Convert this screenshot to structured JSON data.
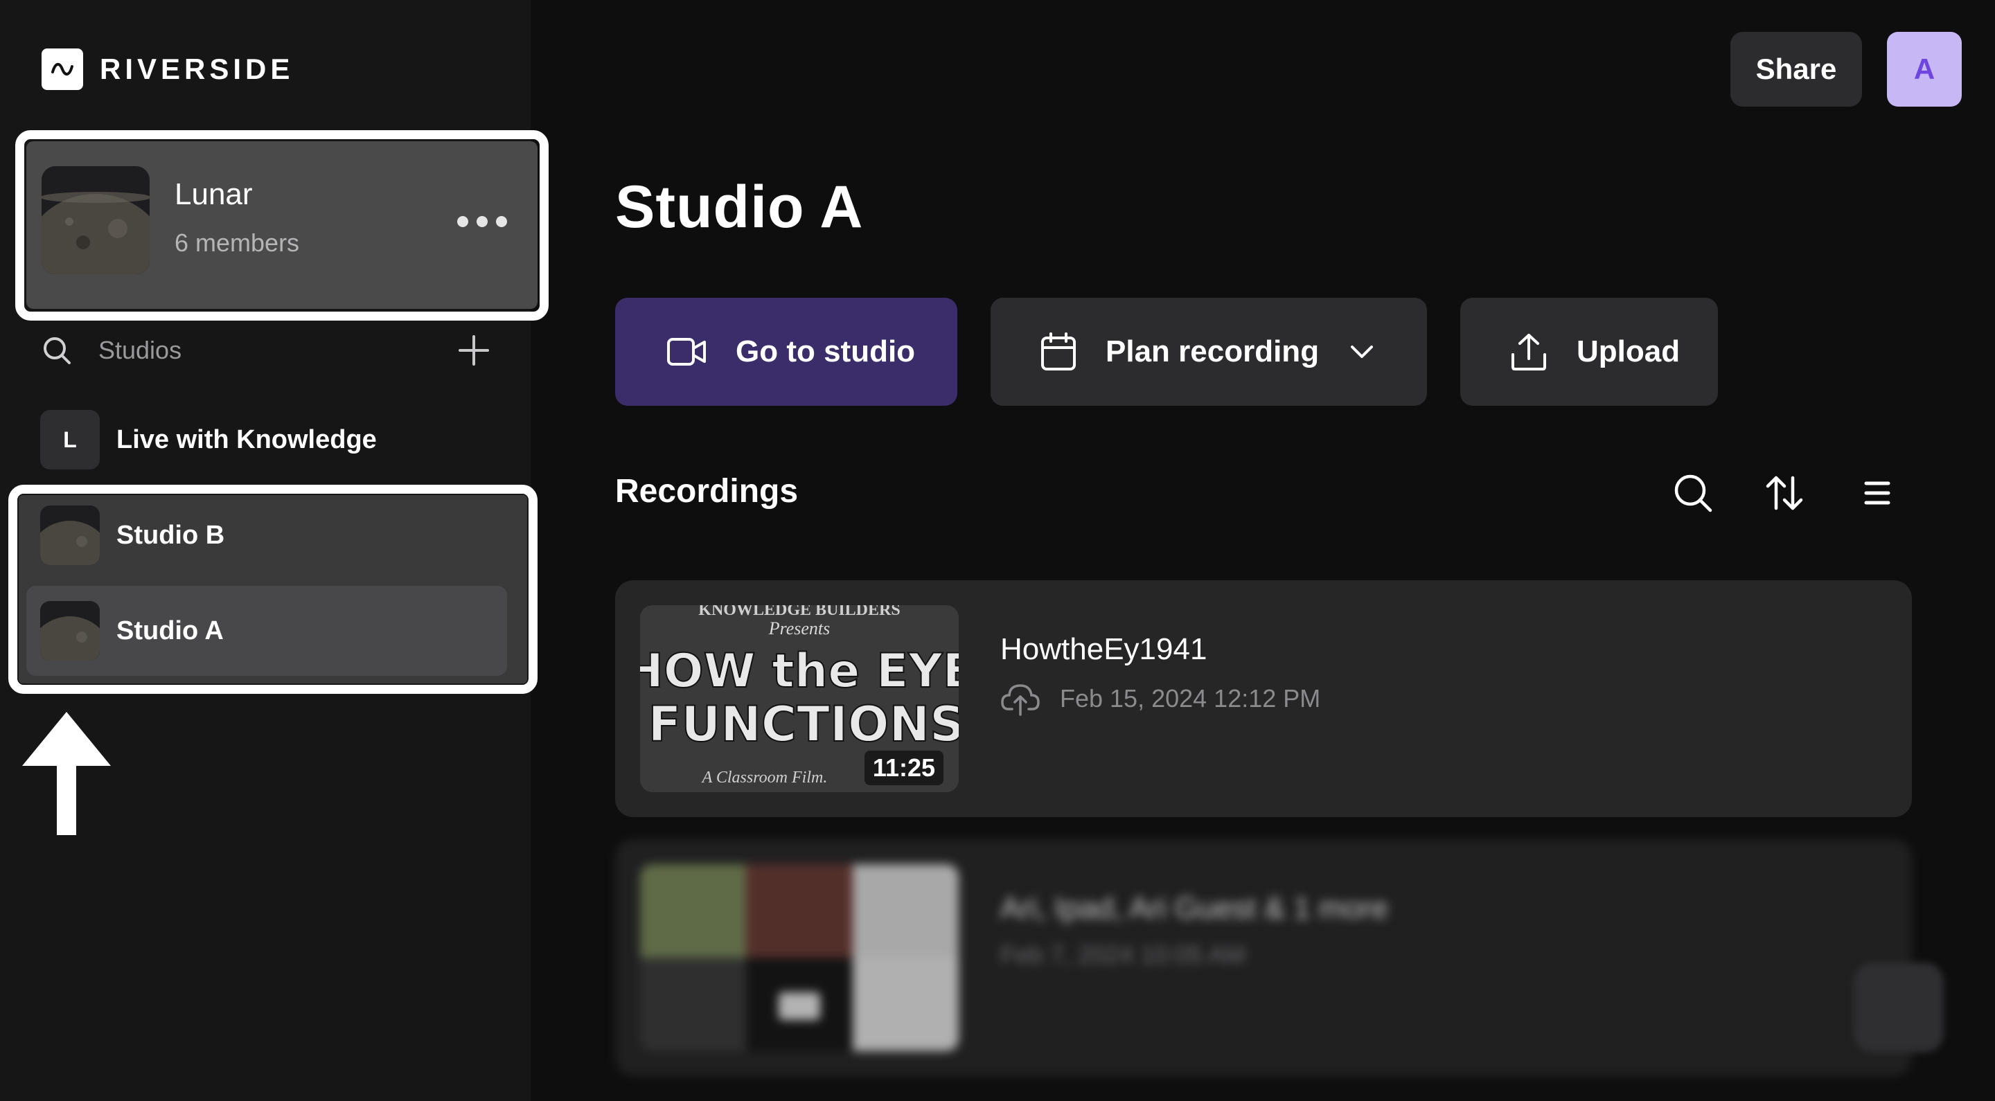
{
  "brand": {
    "name": "RIVERSIDE"
  },
  "workspace": {
    "name": "Lunar",
    "members": "6 members"
  },
  "sidebar": {
    "studios_label": "Studios",
    "items": [
      {
        "letter": "L",
        "label": "Live with Knowledge"
      },
      {
        "label": "Studio B"
      },
      {
        "label": "Studio A"
      }
    ]
  },
  "header": {
    "share_label": "Share",
    "avatar_initial": "A"
  },
  "main": {
    "title": "Studio A",
    "actions": {
      "go_to_studio": "Go to studio",
      "plan_recording": "Plan recording",
      "upload": "Upload"
    },
    "recordings": {
      "title": "Recordings",
      "items": [
        {
          "title": "HowtheEy1941",
          "date": "Feb 15, 2024 12:12 PM",
          "duration": "11:25"
        },
        {
          "title": "Ari, Ipad, Ari Guest & 1 more",
          "date": "Feb 7, 2024 10:05 AM"
        }
      ]
    }
  },
  "colors": {
    "primary_button": "#3a2d6a",
    "avatar_bg": "#c7b8f5",
    "avatar_text": "#6f45e0"
  }
}
